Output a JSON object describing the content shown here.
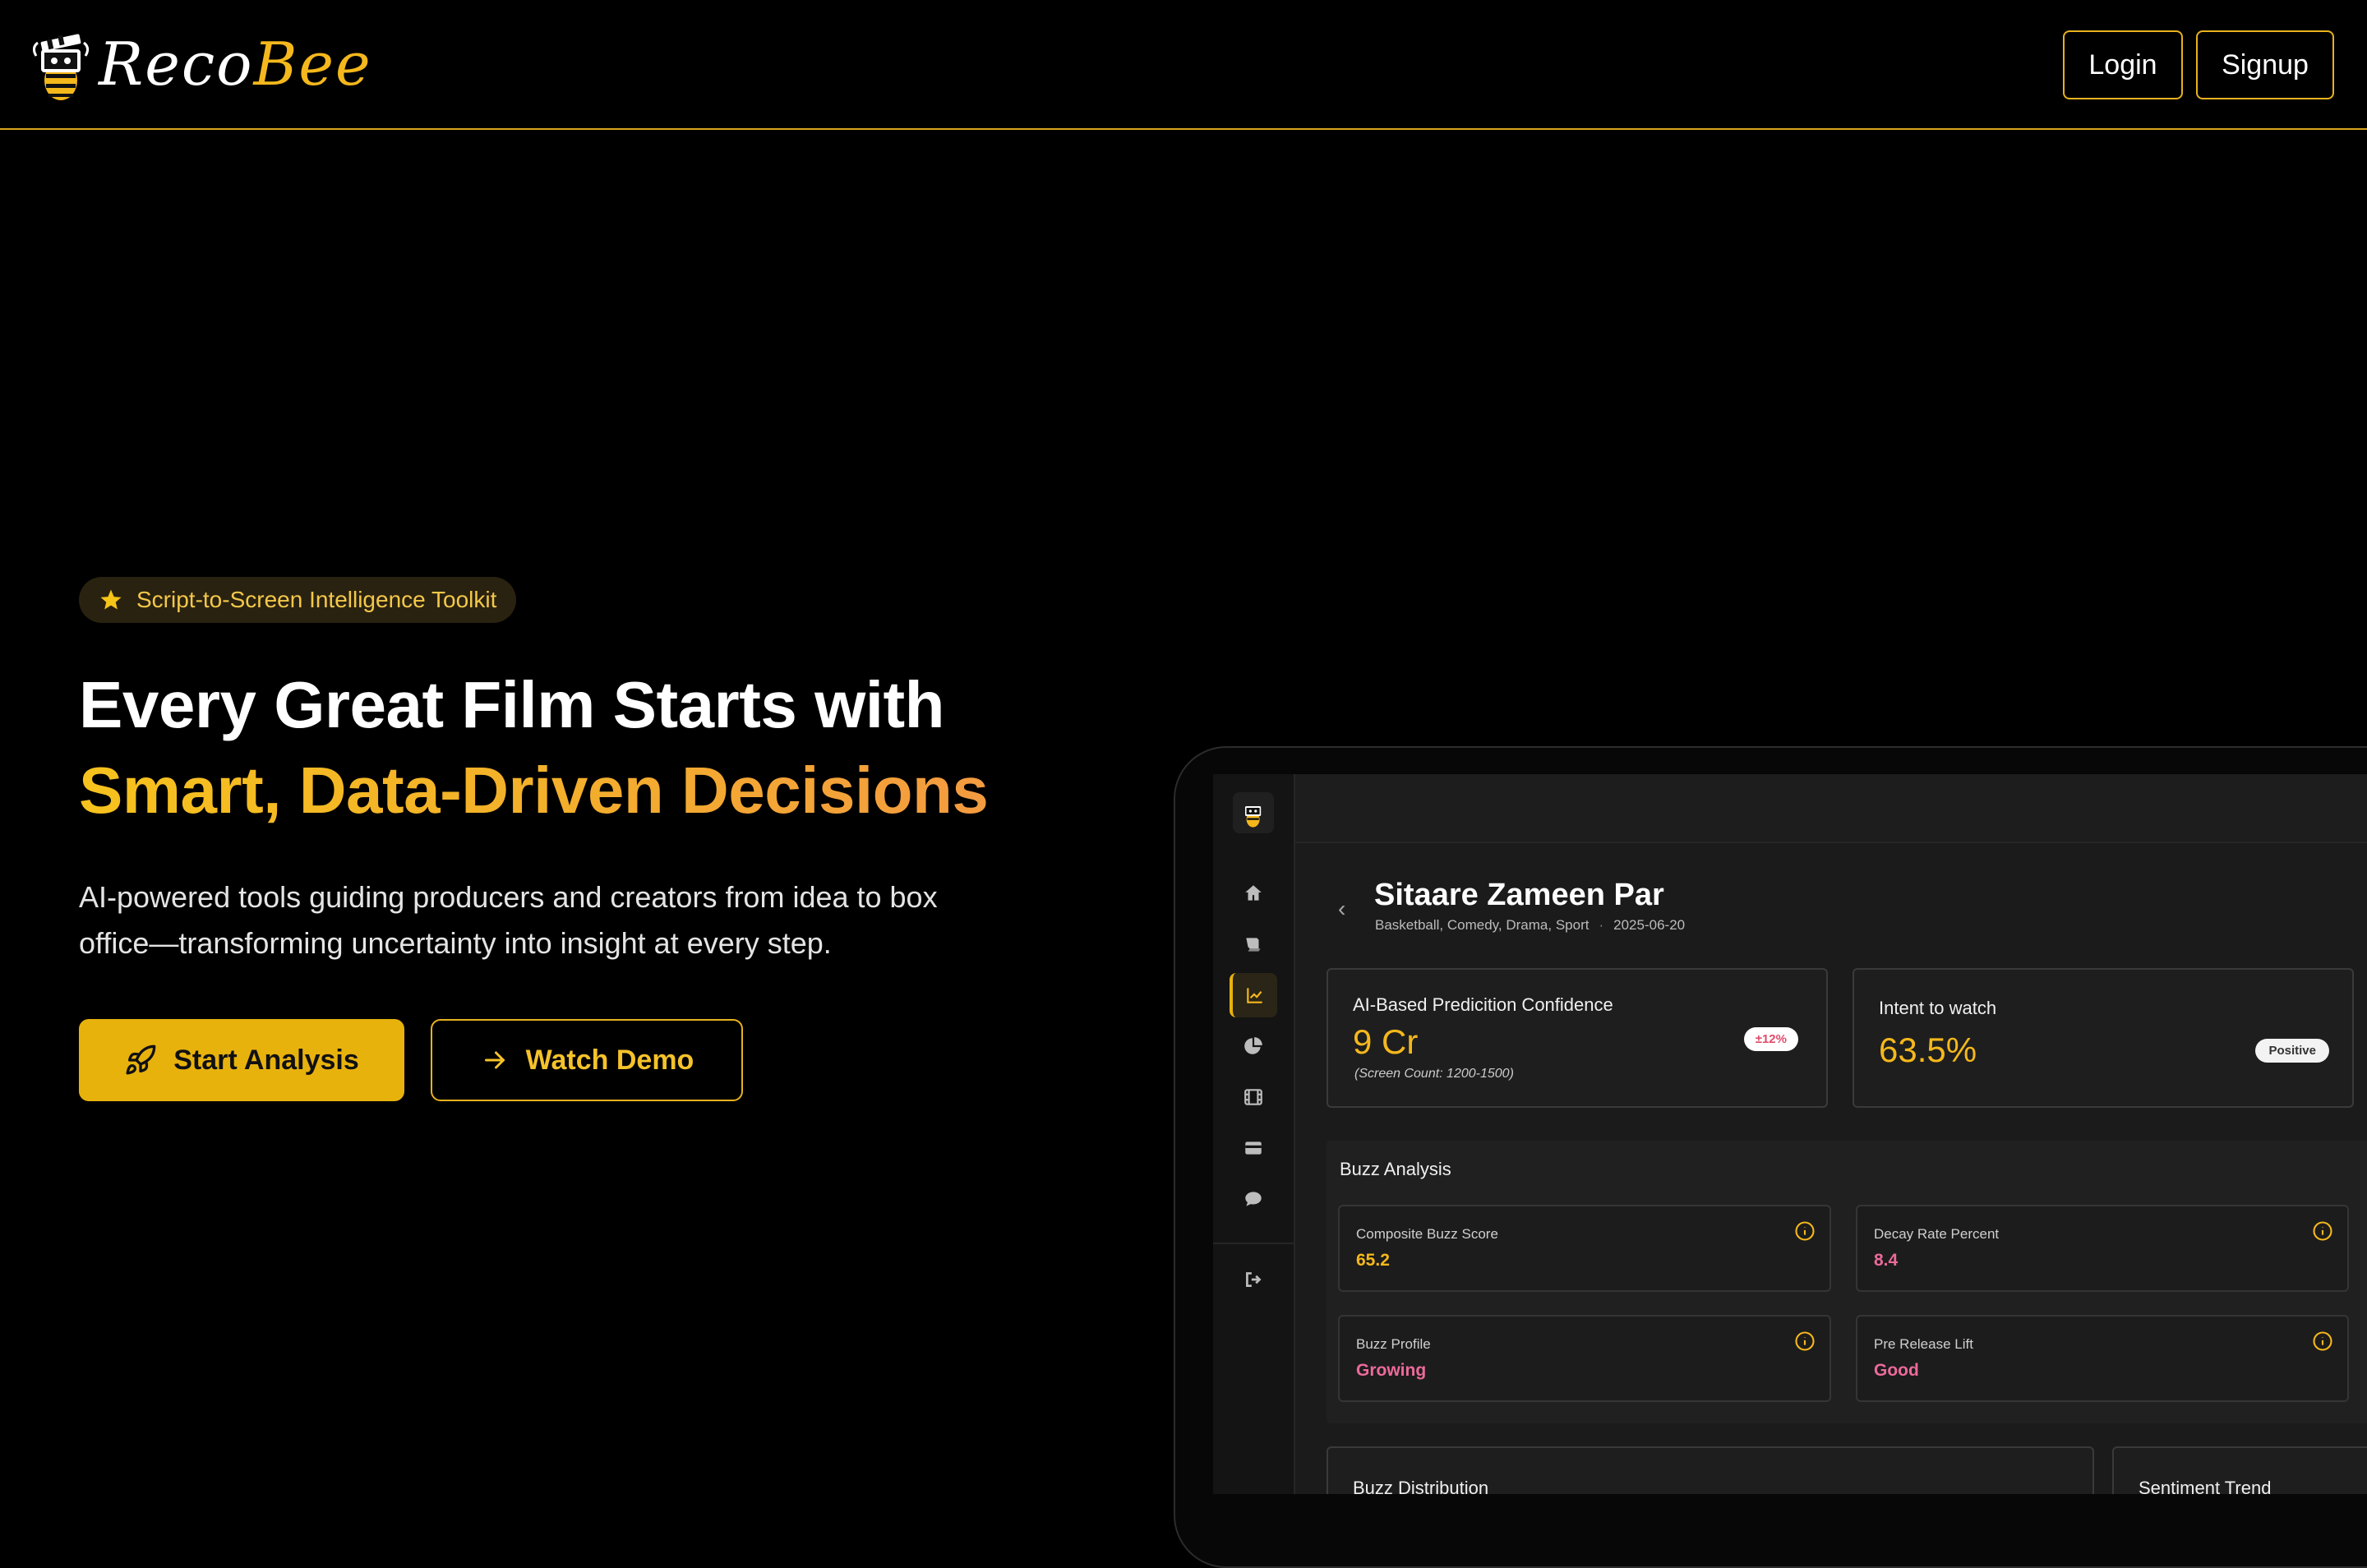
{
  "header": {
    "logo_word_1": "Reco",
    "logo_word_2": "Bee",
    "login_label": "Login",
    "signup_label": "Signup"
  },
  "hero": {
    "badge": "Script-to-Screen Intelligence Toolkit",
    "headline_line1": "Every Great Film Starts with",
    "headline_line2": "Smart, Data-Driven Decisions",
    "subtitle": "AI-powered tools guiding producers and creators from idea to box office—transforming uncertainty into insight at every step.",
    "primary_cta": "Start Analysis",
    "secondary_cta": "Watch Demo"
  },
  "dashboard": {
    "sidebar_icons": [
      "home-icon",
      "scripts-icon",
      "analytics-icon",
      "pie-chart-icon",
      "film-icon",
      "card-icon",
      "chat-icon",
      "logout-icon"
    ],
    "active_nav": "analytics-icon",
    "movie": {
      "title": "Sitaare Zameen Par",
      "genres": "Basketball, Comedy, Drama, Sport",
      "release_date": "2025-06-20"
    },
    "prediction": {
      "title": "AI-Based Predicition Confidence",
      "value": "9 Cr",
      "note": "(Screen Count: 1200-1500)",
      "badge": "±12%"
    },
    "intent": {
      "title": "Intent to watch",
      "value": "63.5%",
      "badge": "Positive"
    },
    "buzz": {
      "title": "Buzz Analysis",
      "metrics": [
        {
          "label": "Composite Buzz Score",
          "value": "65.2"
        },
        {
          "label": "Decay Rate Percent",
          "value": "8.4"
        },
        {
          "label": "Buzz Profile",
          "value": "Growing"
        },
        {
          "label": "Pre Release Lift",
          "value": "Good"
        }
      ]
    },
    "bottom_cards": [
      "Buzz Distribution",
      "Sentiment Trend"
    ],
    "colors": {
      "accent": "#e8b20d",
      "accent_text": "#f5b81c",
      "pink": "#ec6a9b",
      "background": "#000000",
      "panel": "#1b1b1b"
    }
  }
}
